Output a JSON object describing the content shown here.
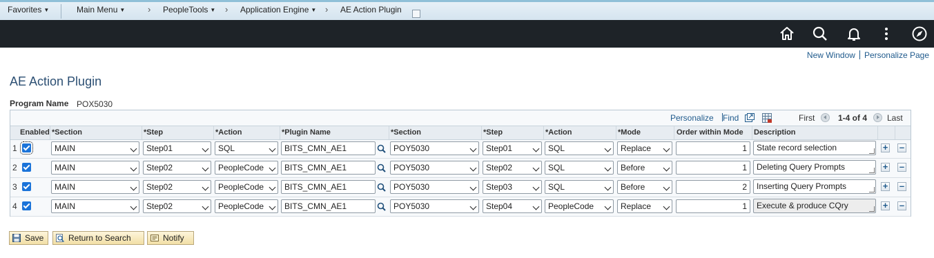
{
  "breadcrumb": {
    "items": [
      "Favorites",
      "Main Menu",
      "PeopleTools",
      "Application Engine",
      "AE Action Plugin"
    ]
  },
  "header_icons": [
    "home-icon",
    "search-icon",
    "bell-icon",
    "more-vertical-icon",
    "navigator-icon"
  ],
  "links": {
    "new_window": "New Window",
    "personalize_page": "Personalize Page"
  },
  "page": {
    "title": "AE Action Plugin",
    "program_name_label": "Program Name",
    "program_name": "POX5030"
  },
  "grid": {
    "nav": {
      "personalize": "Personalize",
      "find": "Find",
      "first": "First",
      "range": "1-4 of 4",
      "last": "Last"
    },
    "columns": {
      "enabled": "Enabled",
      "section1": "*Section",
      "step1": "*Step",
      "action1": "*Action",
      "plugin_name": "*Plugin Name",
      "section2": "*Section",
      "step2": "*Step",
      "action2": "*Action",
      "mode": "*Mode",
      "order": "Order within Mode",
      "description": "Description"
    },
    "rows": [
      {
        "num": "1",
        "enabled": true,
        "section1": "MAIN",
        "step1": "Step01",
        "action1": "SQL",
        "plugin": "BITS_CMN_AE1",
        "section2": "POY5030",
        "step2": "Step01",
        "action2": "SQL",
        "mode": "Replace",
        "order": "1",
        "description": "State record selection"
      },
      {
        "num": "2",
        "enabled": true,
        "section1": "MAIN",
        "step1": "Step02",
        "action1": "PeopleCode",
        "plugin": "BITS_CMN_AE1",
        "section2": "POY5030",
        "step2": "Step02",
        "action2": "SQL",
        "mode": "Before",
        "order": "1",
        "description": "Deleting Query Prompts"
      },
      {
        "num": "3",
        "enabled": true,
        "section1": "MAIN",
        "step1": "Step02",
        "action1": "PeopleCode",
        "plugin": "BITS_CMN_AE1",
        "section2": "POY5030",
        "step2": "Step03",
        "action2": "SQL",
        "mode": "Before",
        "order": "2",
        "description": "Inserting Query Prompts"
      },
      {
        "num": "4",
        "enabled": true,
        "section1": "MAIN",
        "step1": "Step02",
        "action1": "PeopleCode",
        "plugin": "BITS_CMN_AE1",
        "section2": "POY5030",
        "step2": "Step04",
        "action2": "PeopleCode",
        "mode": "Replace",
        "order": "1",
        "description": "Execute & produce CQry"
      }
    ]
  },
  "buttons": {
    "save": "Save",
    "return_to_search": "Return to Search",
    "notify": "Notify"
  }
}
